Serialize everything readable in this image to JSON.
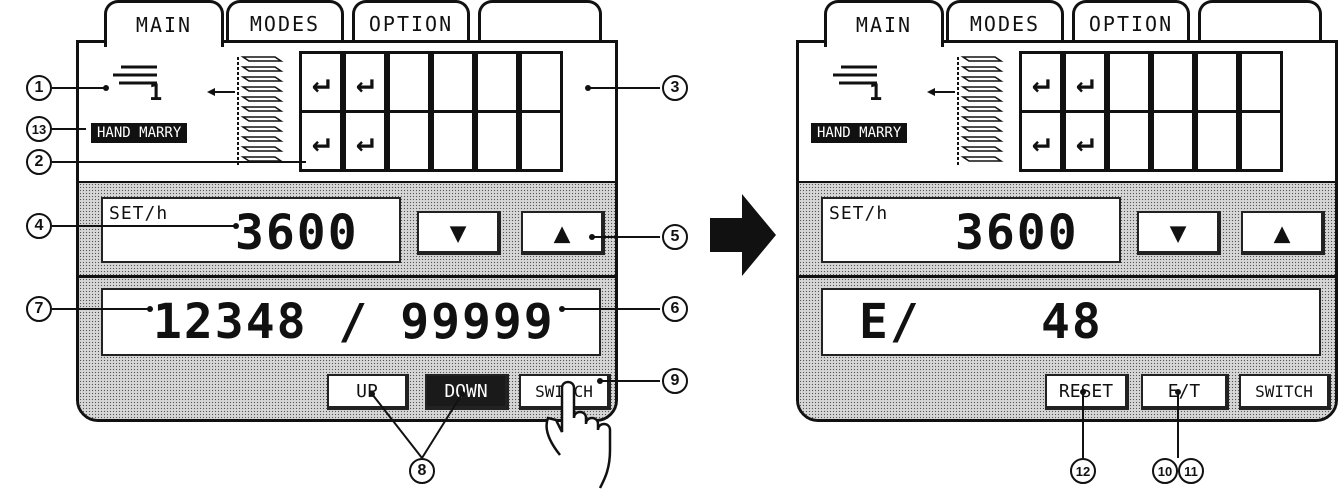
{
  "tabs": [
    "MAIN",
    "MODES",
    "OPTION",
    ""
  ],
  "left": {
    "counter_digit": "1",
    "badge": "HAND MARRY",
    "cells": [
      "↵",
      "↵",
      "",
      "",
      "",
      "",
      "↵",
      "↵",
      "",
      "",
      "",
      ""
    ],
    "set_label": "SET/h",
    "set_value": "3600",
    "down_arrow": "▼",
    "up_arrow": "▲",
    "count_value": "12348 / 99999",
    "buttons": [
      "UP",
      "DOWN",
      "SWITCH"
    ]
  },
  "right": {
    "counter_digit": "1",
    "badge": "HAND MARRY",
    "cells": [
      "↵",
      "↵",
      "",
      "",
      "",
      "",
      "↵",
      "↵",
      "",
      "",
      "",
      ""
    ],
    "set_label": "SET/h",
    "set_value": "3600",
    "down_arrow": "▼",
    "up_arrow": "▲",
    "mode_value": "E/",
    "count_value": "48",
    "buttons": [
      "RESET",
      "E/T",
      "SWITCH"
    ]
  },
  "callouts": {
    "c1": "1",
    "c2": "2",
    "c3": "3",
    "c4": "4",
    "c5": "5",
    "c6": "6",
    "c7": "7",
    "c8": "8",
    "c9": "9",
    "c10": "10",
    "c11": "11",
    "c12": "12",
    "c13": "13"
  },
  "icons": {
    "hand": "hand-pointer-icon",
    "transition": "right-arrow-icon"
  }
}
